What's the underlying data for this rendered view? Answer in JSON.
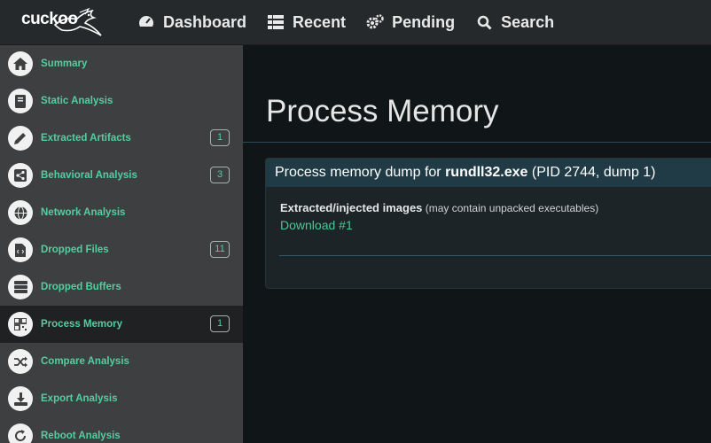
{
  "brand": {
    "logo_text": "cuckoo"
  },
  "nav": [
    {
      "label": "Dashboard",
      "icon": "dashboard-gauge-icon"
    },
    {
      "label": "Recent",
      "icon": "list-icon"
    },
    {
      "label": "Pending",
      "icon": "gears-icon"
    },
    {
      "label": "Search",
      "icon": "search-icon"
    }
  ],
  "sidebar": {
    "items": [
      {
        "label": "Summary",
        "icon": "home-icon",
        "badge": null
      },
      {
        "label": "Static Analysis",
        "icon": "book-icon",
        "badge": null
      },
      {
        "label": "Extracted Artifacts",
        "icon": "pencil-icon",
        "badge": "1"
      },
      {
        "label": "Behavioral Analysis",
        "icon": "share-icon",
        "badge": "3"
      },
      {
        "label": "Network Analysis",
        "icon": "globe-icon",
        "badge": null
      },
      {
        "label": "Dropped Files",
        "icon": "code-file-icon",
        "badge": "11"
      },
      {
        "label": "Dropped Buffers",
        "icon": "server-icon",
        "badge": null
      },
      {
        "label": "Process Memory",
        "icon": "qrcode-icon",
        "badge": "1",
        "active": true
      },
      {
        "label": "Compare Analysis",
        "icon": "shuffle-icon",
        "badge": null
      },
      {
        "label": "Export Analysis",
        "icon": "download-icon",
        "badge": null
      },
      {
        "label": "Reboot Analysis",
        "icon": "refresh-icon",
        "badge": null
      }
    ]
  },
  "main": {
    "title": "Process Memory",
    "panel": {
      "head_prefix": "Process memory dump for ",
      "head_process": "rundll32.exe",
      "head_suffix": " (PID 2744, dump 1)",
      "extract_label": "Extracted/injected images",
      "extract_note": " (may contain unpacked executables)",
      "download_label": "Download #1"
    }
  },
  "colors": {
    "accent": "#52cfa0",
    "topbar": "#26292b",
    "sidebar": "#3d3f40",
    "main_bg": "#101617",
    "panel_head": "#203b46"
  }
}
